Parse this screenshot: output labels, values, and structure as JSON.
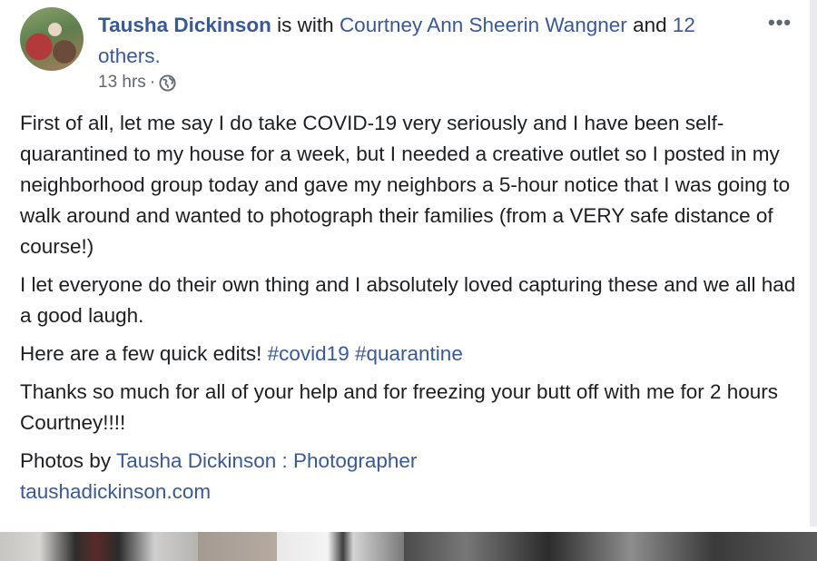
{
  "post": {
    "author": "Tausha Dickinson",
    "with_text": "is with",
    "tagged_person": "Courtney Ann Sheerin Wangner",
    "and_text": "and",
    "others_count_text": "12 others.",
    "timestamp": "13 hrs",
    "separator": "·",
    "audience_icon": "globe-icon",
    "more_icon": "•••",
    "paragraphs": [
      "First of all, let me say I do take COVID-19 very seriously and I have been self-quarantined to my house for a week, but I needed a creative outlet so I posted in my neighborhood group today and gave my neighbors a 5-hour notice that I was going to walk around and wanted to photograph their families (from a VERY safe distance of course!)",
      "I let everyone do their own thing and I absolutely loved capturing these and we all had a good laugh."
    ],
    "edits_text": "Here are a few quick edits!",
    "hashtags": [
      "#covid19",
      "#quarantine"
    ],
    "thanks_text": "Thanks so much for all of your help and for freezing your butt off with me for 2 hours Courtney!!!!",
    "photos_by_text": "Photos by",
    "photographer_link": "Tausha Dickinson : Photographer",
    "website_link": "taushadickinson.com"
  },
  "colors": {
    "link": "#385898",
    "text": "#1c1e21",
    "muted": "#606770"
  }
}
